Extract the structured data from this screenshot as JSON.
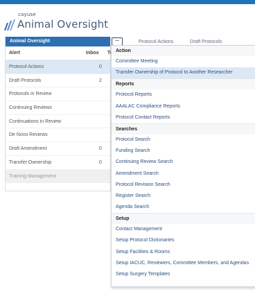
{
  "app": {
    "brand_small": "cayuse",
    "brand_name": "Animal Oversight"
  },
  "colors": {
    "accent": "#1f73b7",
    "panel_header": "#2d6fb0",
    "selected_row": "#dbe8f6",
    "menu_text": "#2b4f80"
  },
  "panel": {
    "title": "Animal Oversight",
    "col_alert": "Alert",
    "col_inbox": "Inbox",
    "col_total": "To",
    "rows": [
      {
        "label": "Protocol Actions",
        "inbox": "0"
      },
      {
        "label": "Draft Protocols",
        "inbox": "2"
      },
      {
        "label": "Protocols in Review",
        "inbox": ""
      },
      {
        "label": "Continuing Reviews",
        "inbox": ""
      },
      {
        "label": "Continuations in Review",
        "inbox": ""
      },
      {
        "label": "De Novo Reviews",
        "inbox": ""
      },
      {
        "label": "Draft Amendment",
        "inbox": "0"
      },
      {
        "label": "Transfer Ownership",
        "inbox": "0"
      },
      {
        "label": "Training Management",
        "inbox": ""
      }
    ]
  },
  "menu_button": {
    "label": "..."
  },
  "background_tabs": [
    "Protocol Actions",
    "Draft Protocols"
  ],
  "menu": {
    "sections": [
      {
        "title": "Action",
        "items": [
          "Committee Meeting",
          "Transfer Ownership of Protocol to Another Researcher"
        ]
      },
      {
        "title": "Reports",
        "items": [
          "Protocol Reports",
          "AAALAC Compliance Reports",
          "Protocol Contact Reports"
        ]
      },
      {
        "title": "Searches",
        "items": [
          "Protocol Search",
          "Funding Search",
          "Continuing Review Search",
          "Amendment Search",
          "Protocol Revision Search",
          "Register Search",
          "Agenda Search"
        ]
      },
      {
        "title": "Setup",
        "items": [
          "Contact Management",
          "Setup Protocol Dictionaries",
          "Setup Facilities & Rooms",
          "Setup IACUC, Reviewers, Committee Members, and Agendas",
          "Setup Surgery Templates"
        ]
      }
    ]
  }
}
